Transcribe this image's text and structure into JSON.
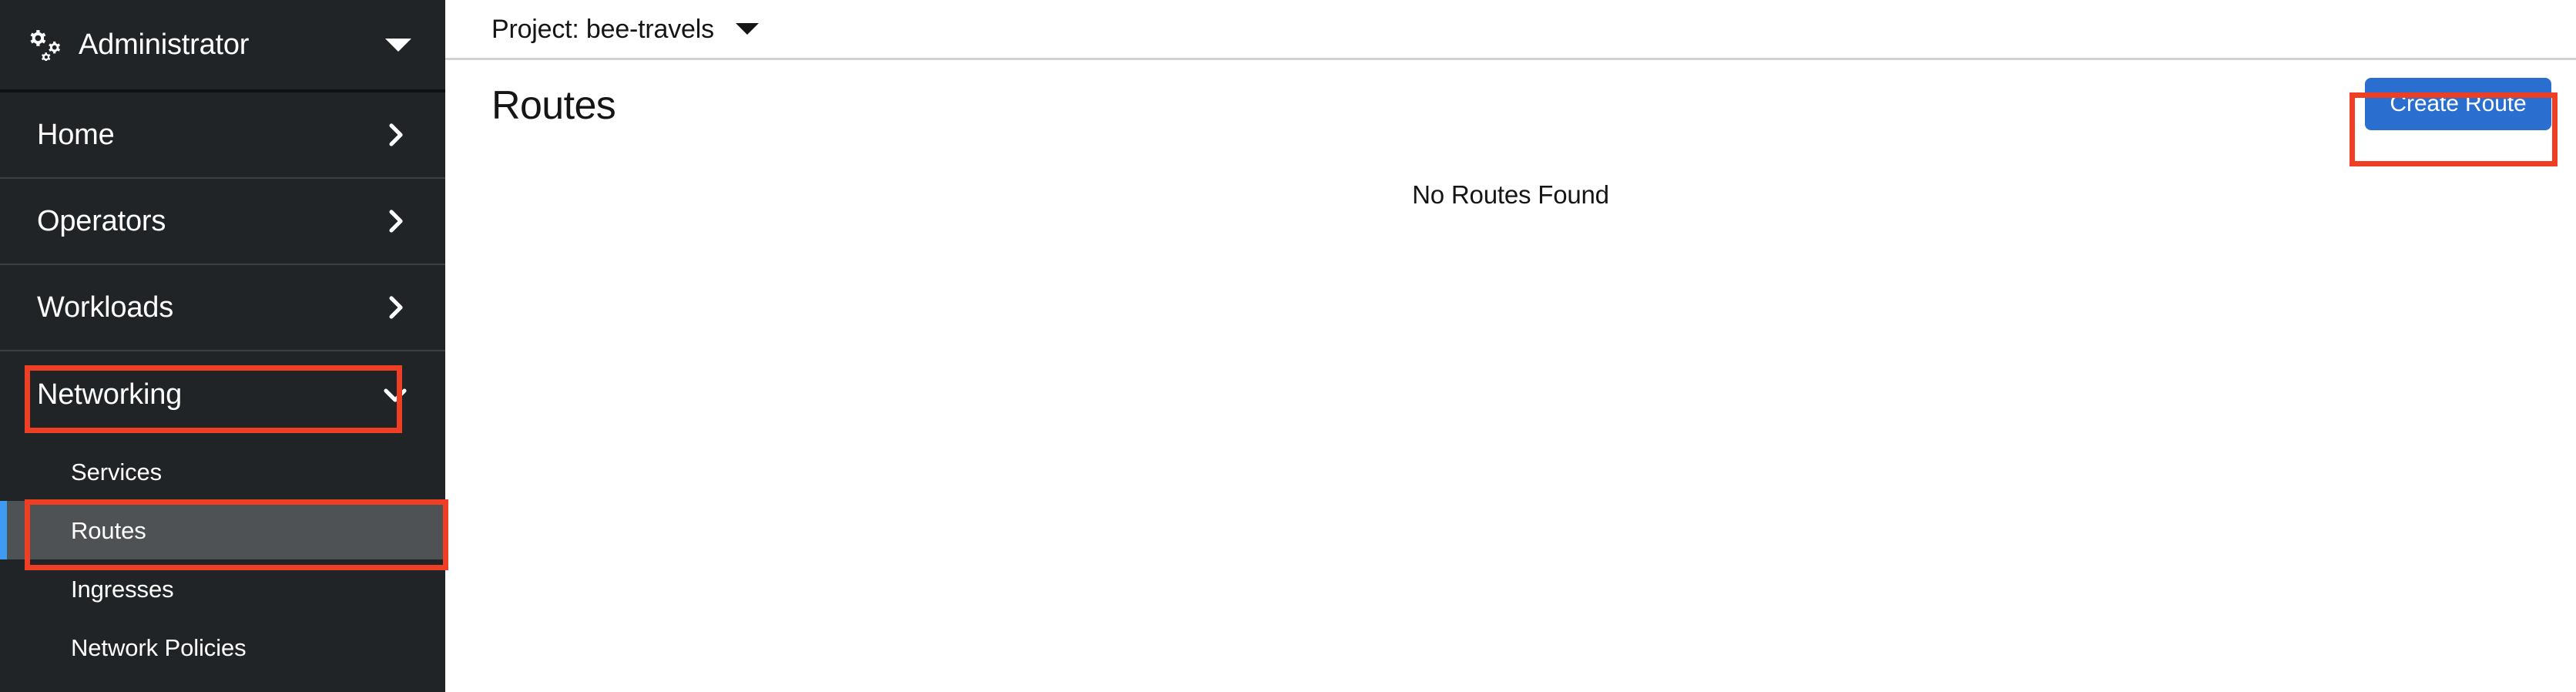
{
  "sidebar": {
    "perspective": {
      "label": "Administrator",
      "icon": "cogs-icon",
      "caret_icon": "caret-down-icon"
    },
    "nav": [
      {
        "label": "Home",
        "icon": "chevron-right-icon",
        "expanded": false
      },
      {
        "label": "Operators",
        "icon": "chevron-right-icon",
        "expanded": false
      },
      {
        "label": "Workloads",
        "icon": "chevron-right-icon",
        "expanded": false
      },
      {
        "label": "Networking",
        "icon": "chevron-down-icon",
        "expanded": true
      }
    ],
    "networking_children": [
      {
        "label": "Services",
        "active": false
      },
      {
        "label": "Routes",
        "active": true
      },
      {
        "label": "Ingresses",
        "active": false
      },
      {
        "label": "Network Policies",
        "active": false
      }
    ]
  },
  "topbar": {
    "project_label": "Project: bee-travels",
    "caret_icon": "caret-down-icon"
  },
  "page": {
    "title": "Routes",
    "create_button": "Create Route",
    "empty_message": "No Routes Found"
  },
  "colors": {
    "sidebar_bg": "#212427",
    "sidebar_active_bg": "#4f5255",
    "active_accent": "#3f9bf2",
    "primary_button": "#2a6fd0",
    "annotation": "#ee3e24",
    "divider": "#3a3f44"
  }
}
